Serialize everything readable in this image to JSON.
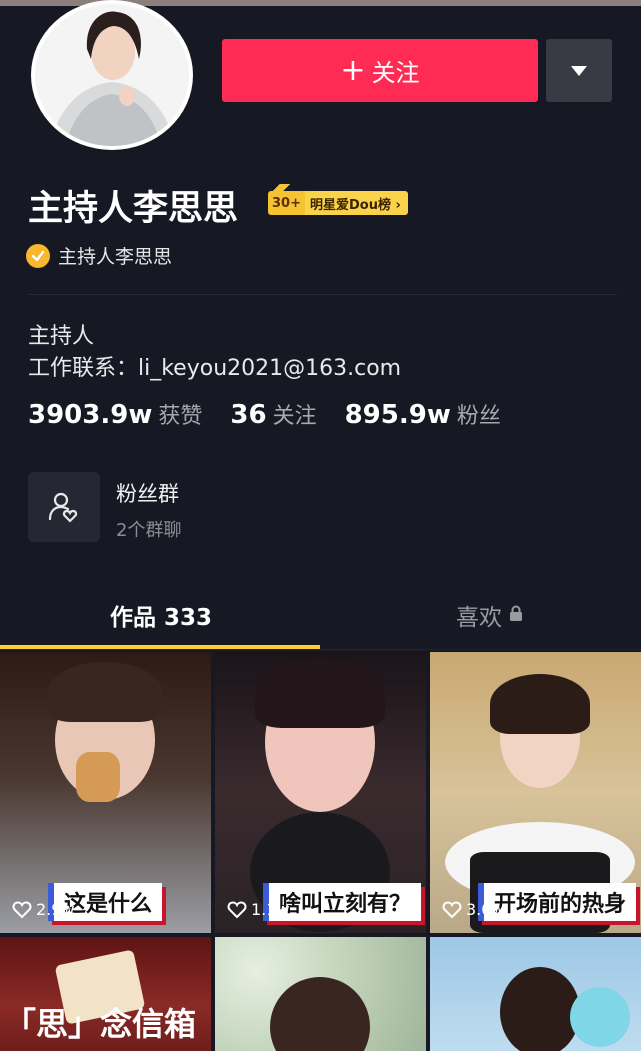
{
  "profile": {
    "nickname": "主持人李思思",
    "rank_number": "30+",
    "rank_label": "明星爱Dou榜 ›",
    "verify_text": "主持人李思思",
    "follow_label": "关注",
    "bio_line1": "主持人",
    "bio_line2": "工作联系：li_keyou2021@163.com"
  },
  "stats": [
    {
      "value": "3903.9w",
      "label": "获赞"
    },
    {
      "value": "36",
      "label": "关注"
    },
    {
      "value": "895.9w",
      "label": "粉丝"
    }
  ],
  "fan_group": {
    "title": "粉丝群",
    "subtitle": "2个群聊"
  },
  "tabs": {
    "works": "作品 333",
    "likes": "喜欢"
  },
  "videos": [
    {
      "caption": "这是什么",
      "likes": "2.9w"
    },
    {
      "caption": "啥叫立刻有？",
      "likes": "1.1w"
    },
    {
      "caption": "开场前的热身",
      "likes": "3.0w"
    },
    {
      "caption": "「思」念信箱",
      "likes": ""
    },
    {
      "caption": "",
      "likes": ""
    },
    {
      "caption": "",
      "likes": ""
    }
  ],
  "icons": [
    "plus-icon",
    "dropdown-arrow-icon",
    "verified-check-icon",
    "fan-group-icon",
    "lock-icon",
    "heart-icon"
  ],
  "colors": {
    "background": "#161823",
    "follow": "#fe2c55",
    "accent": "#fece2f"
  }
}
